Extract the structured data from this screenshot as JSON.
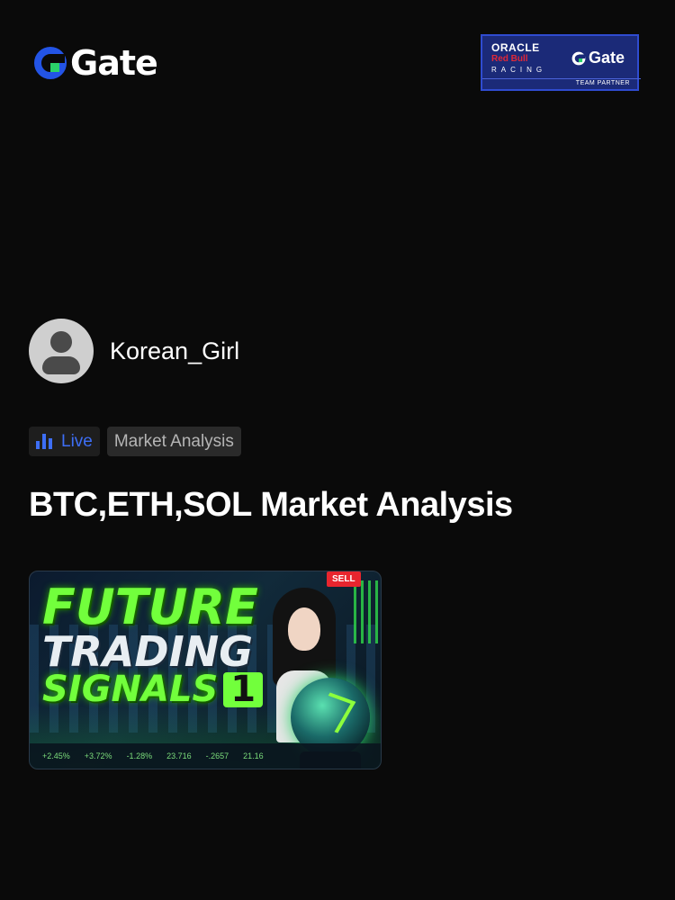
{
  "header": {
    "logo_text": "Gate",
    "logo_icon": "gate-logo-icon",
    "partner": {
      "oracle": "ORACLE",
      "redbull": "Red Bull",
      "racing": "RACING",
      "gate": "Gate",
      "team_partner": "TEAM PARTNER"
    }
  },
  "author": {
    "name": "Korean_Girl",
    "avatar_icon": "default-avatar-icon"
  },
  "tags": {
    "live": "Live",
    "category": "Market Analysis"
  },
  "post": {
    "title": "BTC,ETH,SOL Market Analysis"
  },
  "thumbnail": {
    "line1": "FUTURE",
    "line2": "TRADING",
    "line3": "SIGNALS",
    "number": "1",
    "badge": "SELL",
    "ticker": [
      "+2.45%",
      "+3.72%",
      "-1.28%",
      "23.716",
      "-.2657",
      "21.16"
    ]
  },
  "colors": {
    "brand_blue": "#3d6ef5",
    "background": "#0a0a0a",
    "neon_green": "#72ff3c"
  }
}
